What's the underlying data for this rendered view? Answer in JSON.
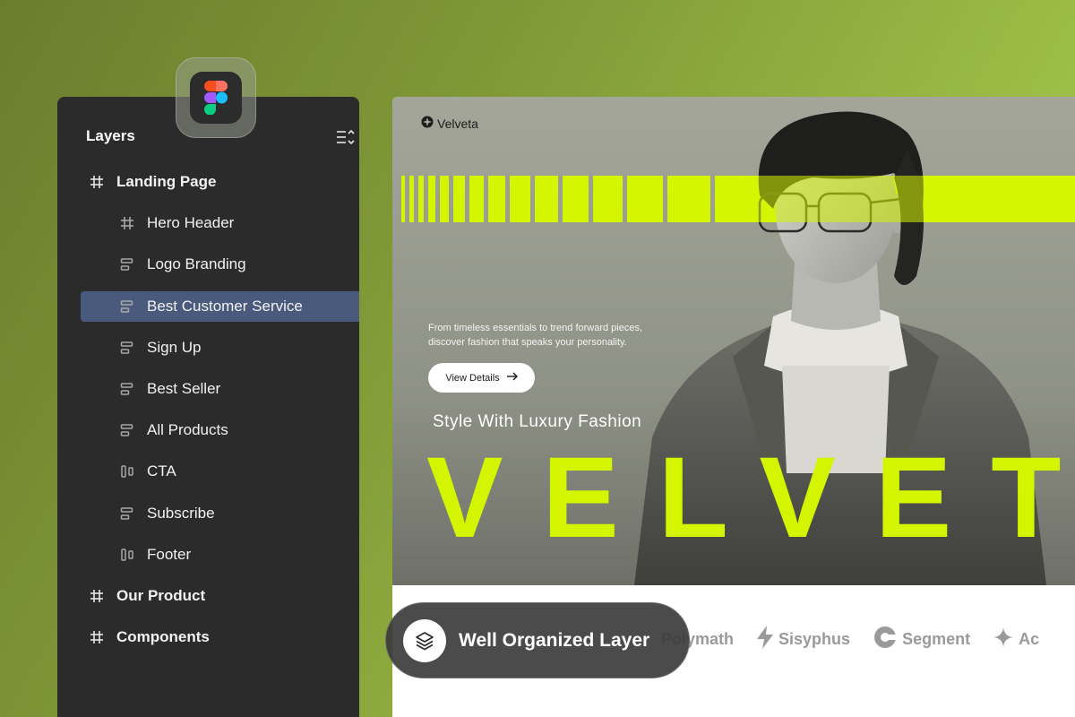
{
  "layers_panel": {
    "title": "Layers",
    "items": [
      {
        "label": "Landing Page",
        "level": 0,
        "icon": "frame-icon"
      },
      {
        "label": "Hero Header",
        "level": 1,
        "icon": "frame-icon"
      },
      {
        "label": "Logo Branding",
        "level": 1,
        "icon": "auto-layout-icon"
      },
      {
        "label": "Best Customer Service",
        "level": 1,
        "icon": "auto-layout-icon",
        "selected": true
      },
      {
        "label": "Sign Up",
        "level": 1,
        "icon": "auto-layout-icon"
      },
      {
        "label": "Best Seller",
        "level": 1,
        "icon": "auto-layout-icon"
      },
      {
        "label": "All Products",
        "level": 1,
        "icon": "auto-layout-icon"
      },
      {
        "label": "CTA",
        "level": 1,
        "icon": "column-layout-icon"
      },
      {
        "label": "Subscribe",
        "level": 1,
        "icon": "auto-layout-icon"
      },
      {
        "label": "Footer",
        "level": 1,
        "icon": "column-layout-icon"
      },
      {
        "label": "Our Product",
        "level": 0,
        "icon": "frame-icon"
      },
      {
        "label": "Components",
        "level": 0,
        "icon": "frame-icon"
      }
    ]
  },
  "preview": {
    "brand": "Velveta",
    "description": "From timeless essentials to trend forward pieces, discover fashion that speaks your personality.",
    "button": "View Details",
    "tagline": "Style With Luxury Fashion",
    "hero_word": "VELVETA",
    "logos": [
      "Polymath",
      "Sisyphus",
      "Segment",
      "Ac"
    ]
  },
  "pill": {
    "label": "Well Organized Layer"
  },
  "colors": {
    "accent": "#d4f500",
    "panel": "#2b2b2b",
    "selected": "#4a5a7c"
  }
}
